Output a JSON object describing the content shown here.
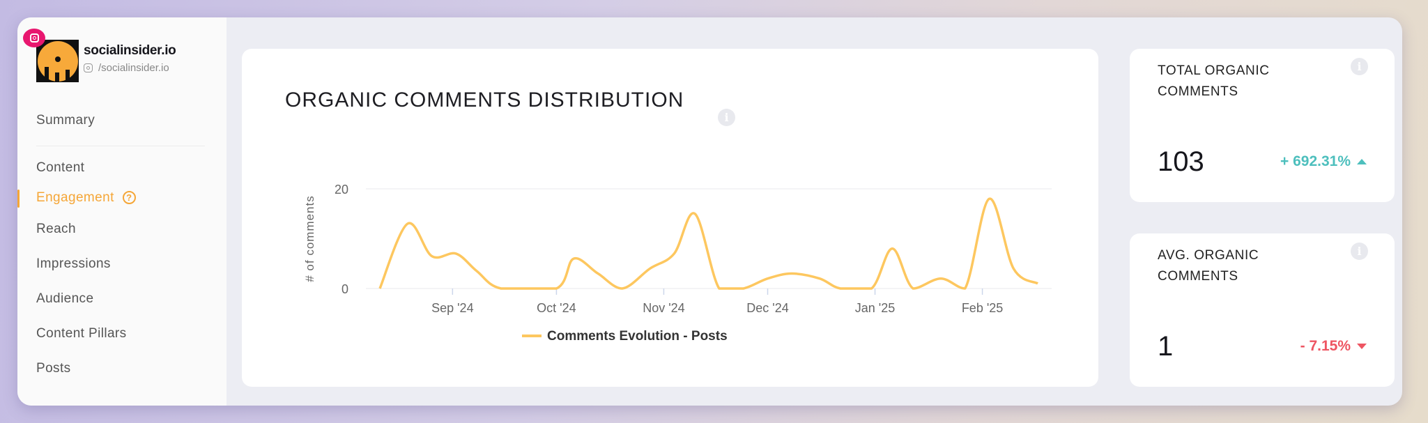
{
  "account": {
    "name": "socialinsider.io",
    "handle": "/socialinsider.io",
    "network_icon": "instagram-icon"
  },
  "sidebar": {
    "items": [
      {
        "label": "Summary"
      },
      {
        "label": "Content"
      },
      {
        "label": "Engagement",
        "active": true
      },
      {
        "label": "Reach"
      },
      {
        "label": "Impressions"
      },
      {
        "label": "Audience"
      },
      {
        "label": "Content Pillars"
      },
      {
        "label": "Posts"
      }
    ]
  },
  "chart_card": {
    "title": "ORGANIC COMMENTS DISTRIBUTION"
  },
  "stats": [
    {
      "title": "TOTAL ORGANIC COMMENTS",
      "value": "103",
      "change": "+ 692.31%",
      "direction": "up",
      "color": "#4dbfbd"
    },
    {
      "title": "AVG. ORGANIC COMMENTS",
      "value": "1",
      "change": "- 7.15%",
      "direction": "down",
      "color": "#ee5562"
    }
  ],
  "colors": {
    "accent": "#f5a637",
    "line": "#fdc75f",
    "positive": "#4dbfbd",
    "negative": "#ee5562"
  },
  "chart_data": {
    "type": "line",
    "ylabel": "# of comments",
    "ylim": [
      0,
      20
    ],
    "yticks": [
      "0",
      "20"
    ],
    "xticks": [
      {
        "date": "2024-09-01",
        "label": "Sep '24"
      },
      {
        "date": "2024-10-01",
        "label": "Oct '24"
      },
      {
        "date": "2024-11-01",
        "label": "Nov '24"
      },
      {
        "date": "2024-12-01",
        "label": "Dec '24"
      },
      {
        "date": "2025-01-01",
        "label": "Jan '25"
      },
      {
        "date": "2025-02-01",
        "label": "Feb '25"
      }
    ],
    "xlim": [
      "2024-08-11",
      "2025-02-19"
    ],
    "legend": "bottom",
    "series": [
      {
        "name": "Comments Evolution - Posts",
        "color": "#fdc75f",
        "points": [
          [
            "2024-08-11",
            0
          ],
          [
            "2024-08-19",
            13
          ],
          [
            "2024-08-26",
            6.5
          ],
          [
            "2024-09-02",
            7
          ],
          [
            "2024-09-08",
            3.5
          ],
          [
            "2024-09-15",
            0
          ],
          [
            "2024-10-01",
            0
          ],
          [
            "2024-10-06",
            6
          ],
          [
            "2024-10-13",
            3
          ],
          [
            "2024-10-20",
            0
          ],
          [
            "2024-10-28",
            4
          ],
          [
            "2024-11-04",
            7
          ],
          [
            "2024-11-10",
            15
          ],
          [
            "2024-11-17",
            0
          ],
          [
            "2024-11-24",
            0
          ],
          [
            "2024-12-01",
            2
          ],
          [
            "2024-12-08",
            3
          ],
          [
            "2024-12-16",
            2
          ],
          [
            "2024-12-22",
            0
          ],
          [
            "2024-12-31",
            0
          ],
          [
            "2025-01-06",
            8
          ],
          [
            "2025-01-12",
            0
          ],
          [
            "2025-01-20",
            2
          ],
          [
            "2025-01-27",
            0
          ],
          [
            "2025-02-03",
            18
          ],
          [
            "2025-02-10",
            4
          ],
          [
            "2025-02-17",
            1
          ]
        ]
      }
    ]
  }
}
